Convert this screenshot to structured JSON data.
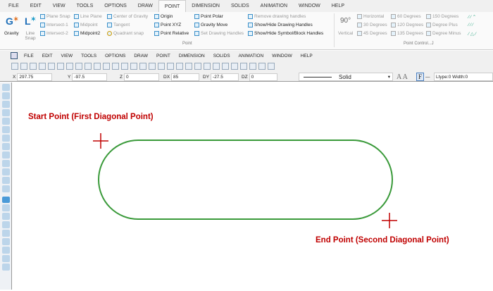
{
  "ribbon_tabs": [
    "FILE",
    "EDIT",
    "VIEW",
    "TOOLS",
    "OPTIONS",
    "DRAW",
    "POINT",
    "DIMENSION",
    "SOLIDS",
    "ANIMATION",
    "WINDOW",
    "HELP"
  ],
  "active_tab": "POINT",
  "ribbon": {
    "gravity": "Gravity",
    "line_snap": "Line Snap",
    "snap_items": [
      "Plane Snap",
      "Intersect-1",
      "Intersect-2",
      "Line Plane",
      "Midpoint",
      "Midpoint2",
      "Center of Gravity",
      "Tangent",
      "Quadrant snap"
    ],
    "point_items": [
      "Origin",
      "Point XYZ",
      "Point Relative",
      "Point Polar",
      "Gravity Move",
      "Set Drawing Handles",
      "Remove drawing handles",
      "Show/Hide Drawing Handles",
      "Show/Hide Symbol/Block Handles"
    ],
    "point_group": "Point",
    "vertical": "Vertical",
    "vertical_icon": "90°",
    "angle_items": [
      "Horizontal",
      "30 Degrees",
      "45 Degrees",
      "60 Degrees",
      "120 Degrees",
      "135 Degrees",
      "150 Degrees",
      "Degree Plus",
      "Degree Minus"
    ],
    "control_group": "Point Control...J"
  },
  "menu": [
    "FILE",
    "EDIT",
    "VIEW",
    "TOOLS",
    "OPTIONS",
    "DRAW",
    "POINT",
    "DIMENSION",
    "SOLIDS",
    "ANIMATION",
    "WINDOW",
    "HELP"
  ],
  "coords": {
    "x_label": "X",
    "x": "297.75",
    "y_label": "Y",
    "y": "-97.5",
    "z_label": "Z",
    "z": "0",
    "dx_label": "DX",
    "dx": "85",
    "dy_label": "DY",
    "dy": "-27.5",
    "dz_label": "DZ",
    "dz": "0",
    "line_style": "Solid",
    "ltype": "Ltype:0  Width:0"
  },
  "canvas": {
    "start_label": "Start Point (First Diagonal Point)",
    "end_label": "End Point (Second Diagonal Point)",
    "shape_color": "#3a9a3a",
    "label_color": "#c00000"
  }
}
